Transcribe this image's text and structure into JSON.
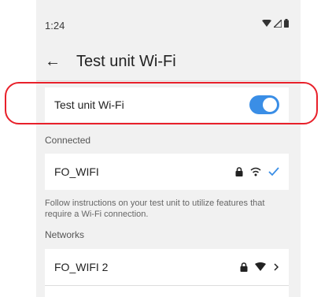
{
  "status_bar": {
    "time": "1:24"
  },
  "app_bar": {
    "title": "Test unit Wi-Fi"
  },
  "wifi_toggle": {
    "label": "Test unit Wi-Fi",
    "on": true
  },
  "connected": {
    "header": "Connected",
    "network": {
      "name": "FO_WIFI",
      "secured": true,
      "connected": true
    },
    "note": "Follow instructions on your test unit to utilize features that require a Wi-Fi connection."
  },
  "networks": {
    "header": "Networks",
    "items": [
      {
        "name": "FO_WIFI 2",
        "secured": true
      }
    ]
  },
  "colors": {
    "accent": "#3a8ee6",
    "highlight": "#e8202a"
  }
}
